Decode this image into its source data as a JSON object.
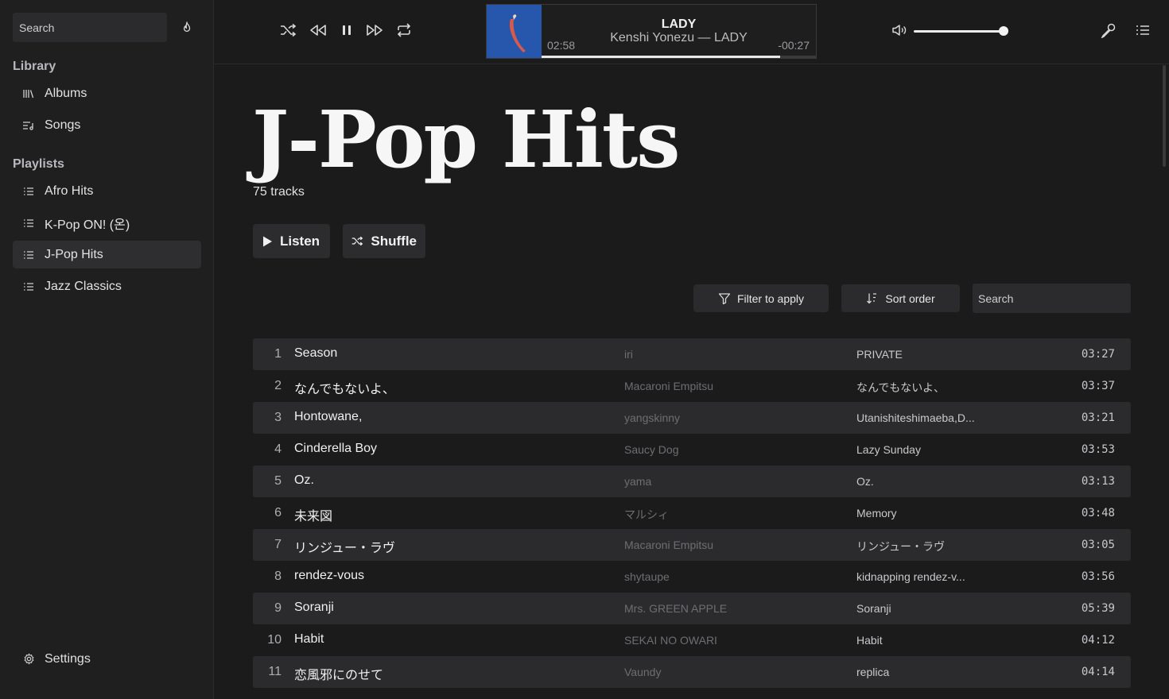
{
  "sidebar": {
    "search_placeholder": "Search",
    "library_title": "Library",
    "library_items": [
      {
        "label": "Albums",
        "icon": "library-icon"
      },
      {
        "label": "Songs",
        "icon": "song-list-icon"
      }
    ],
    "playlists_title": "Playlists",
    "playlists": [
      {
        "label": "Afro Hits",
        "active": false
      },
      {
        "label": "K-Pop ON! (온)",
        "active": false
      },
      {
        "label": "J-Pop Hits",
        "active": true
      },
      {
        "label": "Jazz Classics",
        "active": false
      }
    ],
    "settings_label": "Settings"
  },
  "player": {
    "now_playing_title": "LADY",
    "now_playing_subtitle": "Kenshi Yonezu — LADY",
    "elapsed": "02:58",
    "remaining": "-00:27",
    "progress": 0.87,
    "volume": 1.0
  },
  "playlist": {
    "title": "J-Pop Hits",
    "track_count": "75 tracks",
    "listen_label": "Listen",
    "shuffle_label": "Shuffle"
  },
  "toolbar": {
    "filter_label": "Filter to apply",
    "sort_label": "Sort order",
    "search_placeholder": "Search"
  },
  "tracks": [
    {
      "num": "1",
      "title": "Season",
      "artist": "iri",
      "album": "PRIVATE",
      "duration": "03:27"
    },
    {
      "num": "2",
      "title": "なんでもないよ、",
      "artist": "Macaroni Empitsu",
      "album": "なんでもないよ、",
      "duration": "03:37"
    },
    {
      "num": "3",
      "title": "Hontowane,",
      "artist": "yangskinny",
      "album": "Utanishiteshimaeba,D...",
      "duration": "03:21"
    },
    {
      "num": "4",
      "title": "Cinderella Boy",
      "artist": "Saucy Dog",
      "album": "Lazy Sunday",
      "duration": "03:53"
    },
    {
      "num": "5",
      "title": "Oz.",
      "artist": "yama",
      "album": "Oz.",
      "duration": "03:13"
    },
    {
      "num": "6",
      "title": "未来図",
      "artist": "マルシィ",
      "album": "Memory",
      "duration": "03:48"
    },
    {
      "num": "7",
      "title": "リンジュー・ラヴ",
      "artist": "Macaroni Empitsu",
      "album": "リンジュー・ラヴ",
      "duration": "03:05"
    },
    {
      "num": "8",
      "title": "rendez-vous",
      "artist": "shytaupe",
      "album": "kidnapping rendez-v...",
      "duration": "03:56"
    },
    {
      "num": "9",
      "title": "Soranji",
      "artist": "Mrs. GREEN APPLE",
      "album": "Soranji",
      "duration": "05:39"
    },
    {
      "num": "10",
      "title": "Habit",
      "artist": "SEKAI NO OWARI",
      "album": "Habit",
      "duration": "04:12"
    },
    {
      "num": "11",
      "title": "恋風邪にのせて",
      "artist": "Vaundy",
      "album": "replica",
      "duration": "04:14"
    }
  ]
}
